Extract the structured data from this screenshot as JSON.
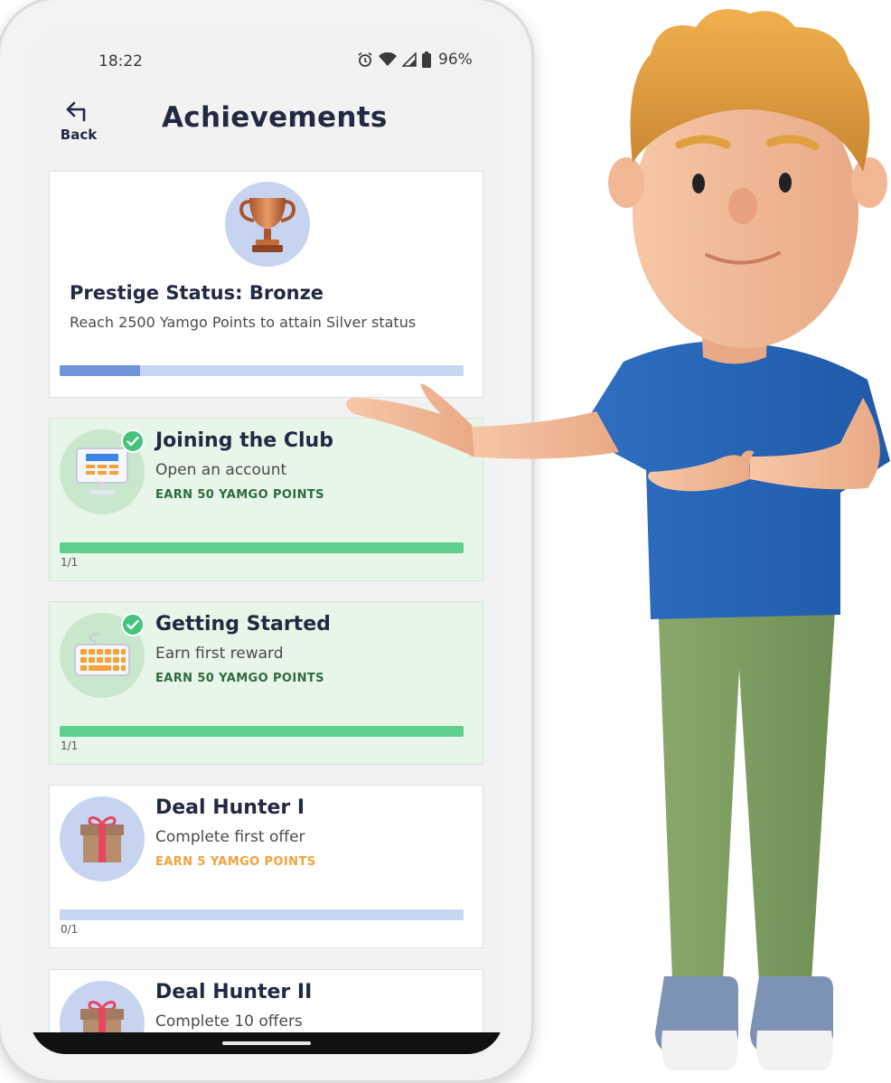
{
  "status_bar": {
    "time": "18:22",
    "battery": "96%"
  },
  "header": {
    "back_label": "Back",
    "title": "Achievements"
  },
  "prestige": {
    "title": "Prestige Status: Bronze",
    "description": "Reach 2500 Yamgo Points to attain Silver status",
    "progress": 0.2
  },
  "achievements": [
    {
      "title": "Joining the Club",
      "description": "Open an account",
      "reward": "EARN 50 YAMGO POINTS",
      "progress_text": "1/1",
      "progress": 1.0,
      "completed": true,
      "icon": "computer-icon"
    },
    {
      "title": "Getting Started",
      "description": "Earn first reward",
      "reward": "EARN 50 YAMGO POINTS",
      "progress_text": "1/1",
      "progress": 1.0,
      "completed": true,
      "icon": "keyboard-icon"
    },
    {
      "title": "Deal Hunter I",
      "description": "Complete first offer",
      "reward": "EARN 5 YAMGO POINTS",
      "progress_text": "0/1",
      "progress": 0.0,
      "completed": false,
      "icon": "gift-icon"
    },
    {
      "title": "Deal Hunter II",
      "description": "Complete 10 offers",
      "completed": false,
      "icon": "gift-icon"
    }
  ],
  "colors": {
    "title_navy": "#222943",
    "completed_bg": "#e8f5e9",
    "progress_green": "#5fcf90",
    "progress_blue": "#6f95d8",
    "reward_green": "#2f6b3e",
    "reward_orange": "#f5a13a"
  }
}
